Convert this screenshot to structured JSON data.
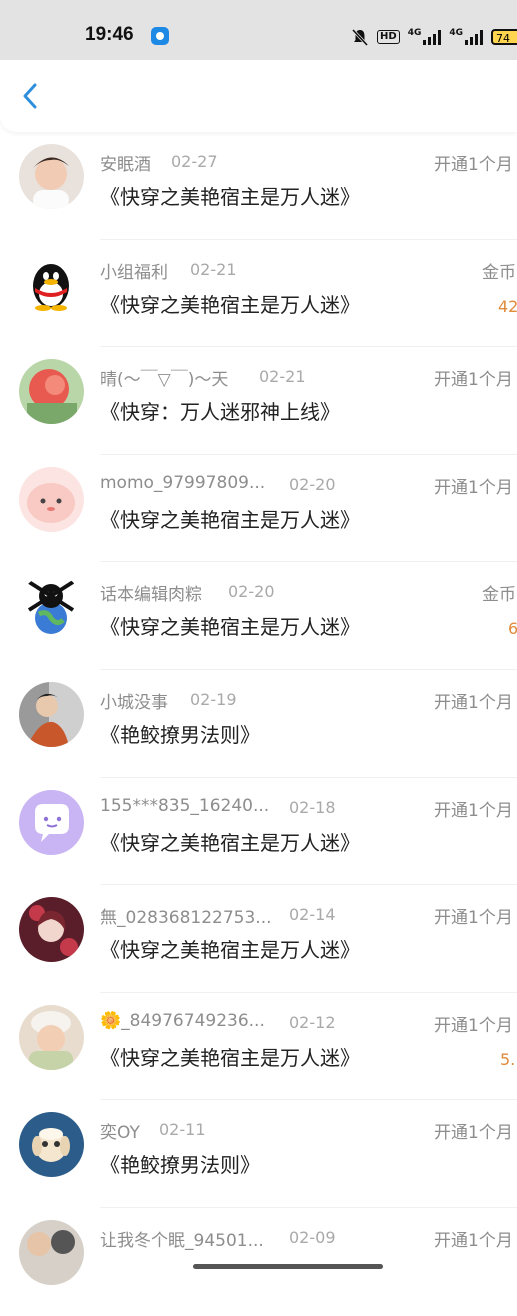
{
  "status_bar": {
    "time": "19:46",
    "network_1": "4G",
    "network_2": "4G",
    "hd_label": "HD",
    "battery": "74"
  },
  "header": {
    "back_icon": "chevron-left-icon"
  },
  "items": [
    {
      "name": "安眠酒",
      "date": "02-27",
      "book": "《快穿之美艳宿主是万人迷》",
      "action": "开通1个月",
      "amount": ""
    },
    {
      "name": "小组福利",
      "date": "02-21",
      "book": "《快穿之美艳宿主是万人迷》",
      "action": "金币",
      "amount": "42"
    },
    {
      "name": "晴(～￣▽￣)～天",
      "date": "02-21",
      "book": "《快穿：万人迷邪神上线》",
      "action": "开通1个月",
      "amount": ""
    },
    {
      "name": "momo_97997809...",
      "date": "02-20",
      "book": "《快穿之美艳宿主是万人迷》",
      "action": "开通1个月",
      "amount": ""
    },
    {
      "name": "话本编辑肉粽",
      "date": "02-20",
      "book": "《快穿之美艳宿主是万人迷》",
      "action": "金币",
      "amount": "6"
    },
    {
      "name": "小城没事",
      "date": "02-19",
      "book": "《艳鲛撩男法则》",
      "action": "开通1个月",
      "amount": ""
    },
    {
      "name": "155***835_16240...",
      "date": "02-18",
      "book": "《快穿之美艳宿主是万人迷》",
      "action": "开通1个月",
      "amount": ""
    },
    {
      "name": "無_028368122753...",
      "date": "02-14",
      "book": "《快穿之美艳宿主是万人迷》",
      "action": "开通1个月",
      "amount": ""
    },
    {
      "name": "🌼_84976749236...",
      "date": "02-12",
      "book": "《快穿之美艳宿主是万人迷》",
      "action": "开通1个月",
      "amount": "5."
    },
    {
      "name": "奕OY",
      "date": "02-11",
      "book": "《艳鲛撩男法则》",
      "action": "开通1个月",
      "amount": ""
    },
    {
      "name": "让我冬个眠_94501...",
      "date": "02-09",
      "book": "",
      "action": "开通1个月",
      "amount": ""
    }
  ]
}
